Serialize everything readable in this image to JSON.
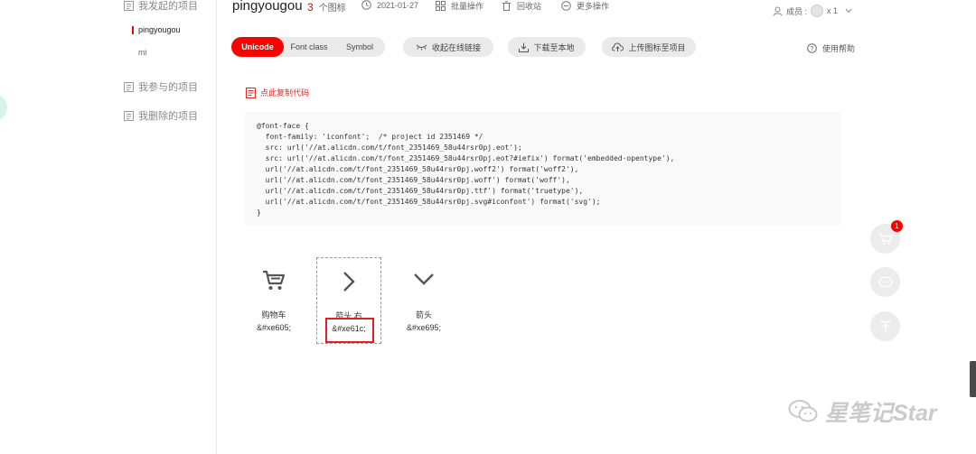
{
  "sidebar": {
    "initiated_projects": "我发起的项目",
    "sub_items": [
      "pingyougou",
      "mi"
    ],
    "participated_projects": "我参与的项目",
    "deleted_projects": "我删除的项目"
  },
  "header": {
    "project_title": "pingyougou",
    "icon_count": "3",
    "icon_count_suffix": "个图标",
    "date": "2021-01-27",
    "batch_ops": "批量操作",
    "recycle_bin": "回收站",
    "more_ops": "更多操作",
    "members_label": "成员 :",
    "members_count": "x 1"
  },
  "toolbar": {
    "tabs": [
      "Unicode",
      "Font class",
      "Symbol"
    ],
    "collapse_link": "收起在线链接",
    "download": "下载至本地",
    "upload": "上传图标至项目",
    "help": "使用帮助"
  },
  "code_panel": {
    "copy_label": "点此复制代码",
    "lines": [
      "@font-face {",
      "  font-family: 'iconfont';  /* project id 2351469 */",
      "  src: url('//at.alicdn.com/t/font_2351469_58u44rsr0pj.eot');",
      "  src: url('//at.alicdn.com/t/font_2351469_58u44rsr0pj.eot?#iefix') format('embedded-opentype'),",
      "  url('//at.alicdn.com/t/font_2351469_58u44rsr0pj.woff2') format('woff2'),",
      "  url('//at.alicdn.com/t/font_2351469_58u44rsr0pj.woff') format('woff'),",
      "  url('//at.alicdn.com/t/font_2351469_58u44rsr0pj.ttf') format('truetype'),",
      "  url('//at.alicdn.com/t/font_2351469_58u44rsr0pj.svg#iconfont') format('svg');",
      "}"
    ]
  },
  "icons": [
    {
      "name": "购物车",
      "code": "&#xe605;",
      "glyph": "cart-icon"
    },
    {
      "name": "箭头 右",
      "code": "&#xe61c;",
      "glyph": "arrow-right-icon"
    },
    {
      "name": "箭头",
      "code": "&#xe695;",
      "glyph": "arrow-down-icon"
    }
  ],
  "float_buttons": {
    "cart_badge": "1"
  },
  "watermark": {
    "text": "星笔记Star"
  },
  "colors": {
    "accent": "#ff0000",
    "highlight_border": "#e02020",
    "tab_bg": "#eaeaea",
    "code_bg": "#f9f9f9"
  }
}
